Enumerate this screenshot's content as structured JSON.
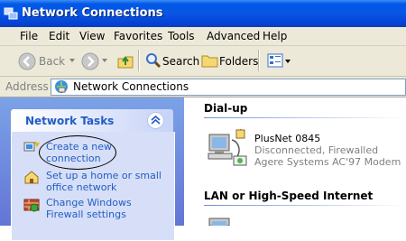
{
  "window": {
    "title": "Network Connections"
  },
  "menu": [
    {
      "label": "File"
    },
    {
      "label": "Edit"
    },
    {
      "label": "View"
    },
    {
      "label": "Favorites"
    },
    {
      "label": "Tools"
    },
    {
      "label": "Advanced"
    },
    {
      "label": "Help"
    }
  ],
  "toolbar": {
    "back_label": "Back",
    "search_label": "Search",
    "folders_label": "Folders"
  },
  "address": {
    "label": "Address",
    "value": "Network Connections"
  },
  "tasks": {
    "title": "Network Tasks",
    "items": [
      {
        "label_line1": "Create a new",
        "label_line2": "connection"
      },
      {
        "label_line1": "Set up a home or small",
        "label_line2": "office network"
      },
      {
        "label_line1": "Change Windows",
        "label_line2": "Firewall settings"
      }
    ]
  },
  "sections": [
    {
      "title": "Dial-up",
      "items": [
        {
          "name": "PlusNet 0845",
          "status": "Disconnected, Firewalled",
          "device": "Agere Systems AC'97 Modem"
        }
      ]
    },
    {
      "title": "LAN or High-Speed Internet"
    }
  ]
}
